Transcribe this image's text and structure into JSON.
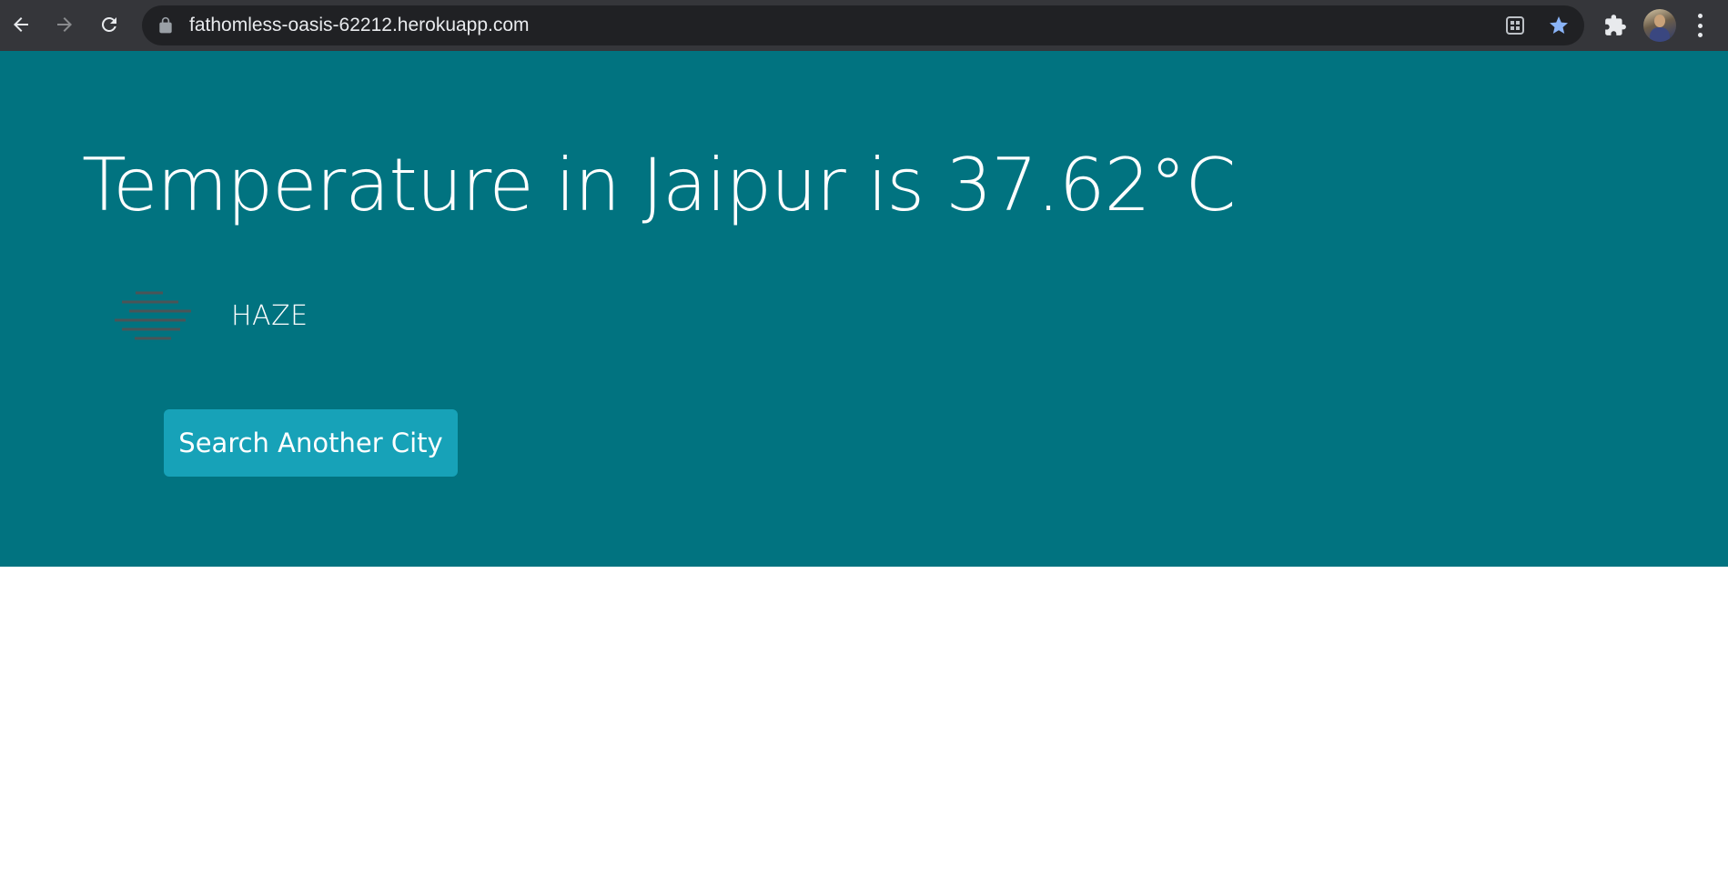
{
  "browser": {
    "url": "fathomless-oasis-62212.herokuapp.com",
    "icons": {
      "back": "arrow-left-icon",
      "forward": "arrow-right-icon",
      "reload": "reload-icon",
      "lock": "lock-icon",
      "install": "app-install-icon",
      "bookmark": "star-icon",
      "extensions": "puzzle-icon",
      "profile": "avatar",
      "menu": "kebab-menu-icon"
    },
    "colors": {
      "chrome_bg": "#35363a",
      "omnibox_bg": "#202124",
      "star": "#8ab4f8"
    }
  },
  "page": {
    "title": "Temperature in Jaipur is 37.62°C",
    "condition": "HAZE",
    "condition_icon": "haze-icon",
    "search_button": "Search Another City",
    "colors": {
      "hero_bg": "#017380",
      "button_bg": "#17a2b8",
      "page_bg": "#ffffff"
    }
  }
}
